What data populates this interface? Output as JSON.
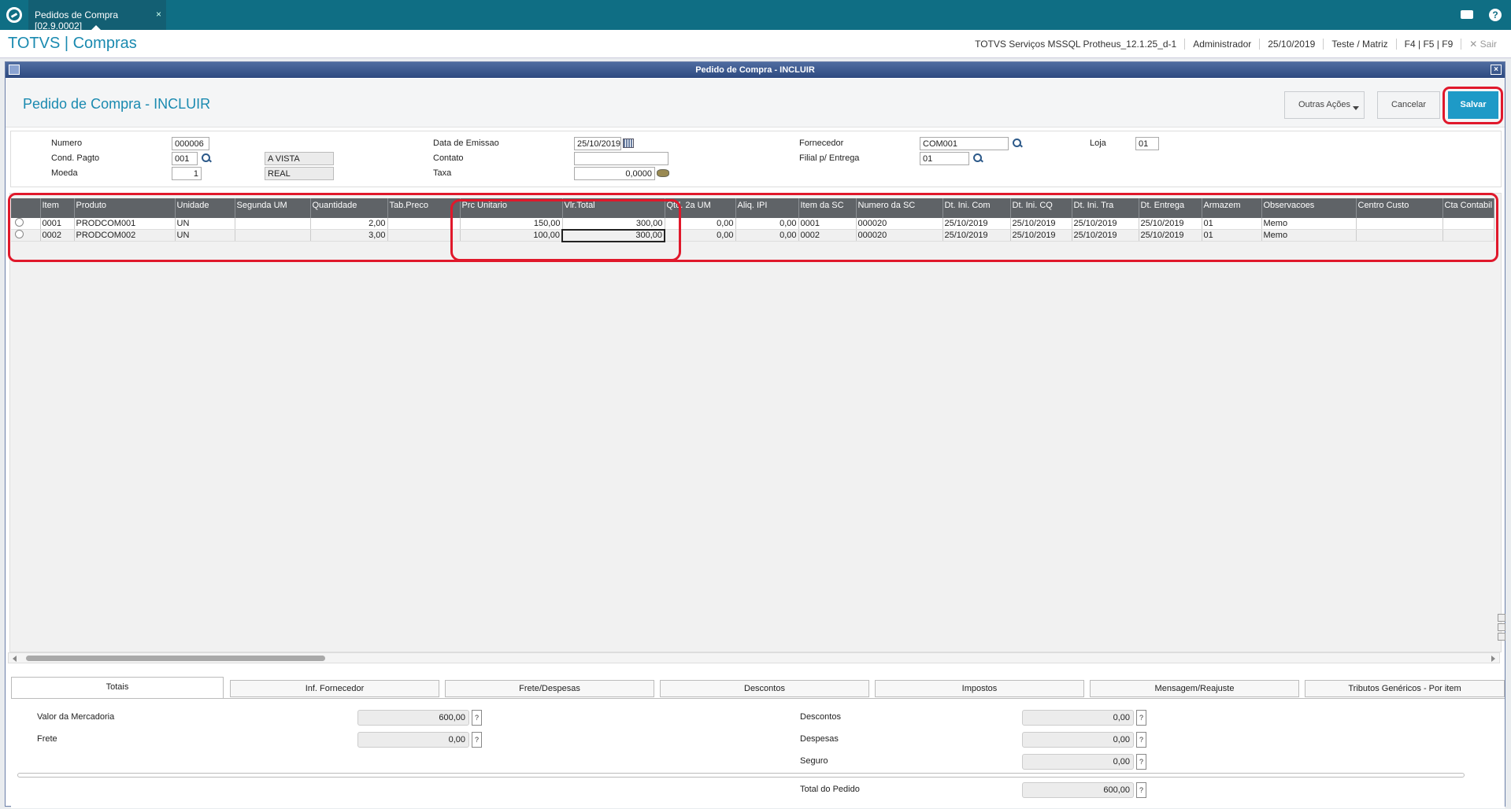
{
  "tabbar": {
    "tab_label": "Pedidos de Compra [02.9.0002]",
    "tab_close": "×",
    "help": "?"
  },
  "header": {
    "brand": "TOTVS | Compras",
    "environment": "TOTVS Serviços MSSQL Protheus_12.1.25_d-1",
    "user": "Administrador",
    "date": "25/10/2019",
    "branch": "Teste / Matriz",
    "shortcuts": "F4 | F5 | F9",
    "logout": "✕  Sair"
  },
  "dialog": {
    "title": "Pedido de Compra - INCLUIR",
    "close": "×",
    "page_title": "Pedido de Compra - INCLUIR",
    "buttons": {
      "outras": "Outras Ações",
      "cancelar": "Cancelar",
      "salvar": "Salvar"
    }
  },
  "form": {
    "numero_label": "Numero",
    "numero": "000006",
    "cond_label": "Cond. Pagto",
    "cond": "001",
    "cond_desc": "A VISTA",
    "moeda_label": "Moeda",
    "moeda": "1",
    "moeda_desc": "REAL",
    "emissao_label": "Data de Emissao",
    "emissao": "25/10/2019",
    "contato_label": "Contato",
    "contato": "",
    "taxa_label": "Taxa",
    "taxa": "0,0000",
    "fornecedor_label": "Fornecedor",
    "fornecedor": "COM001",
    "filial_label": "Filial p/ Entrega",
    "filial": "01",
    "loja_label": "Loja",
    "loja": "01"
  },
  "grid": {
    "columns": [
      "",
      "Item",
      "Produto",
      "Unidade",
      "Segunda UM",
      "Quantidade",
      "Tab.Preco",
      "Prc Unitario",
      "Vlr.Total",
      "Qtd. 2a UM",
      "Aliq. IPI",
      "Item da SC",
      "Numero da SC",
      "Dt. Ini. Com",
      "Dt. Ini. CQ",
      "Dt. Ini. Tra",
      "Dt. Entrega",
      "Armazem",
      "Observacoes",
      "Centro Custo",
      "Cta Contabil"
    ],
    "rows": [
      [
        "",
        "0001",
        "PRODCOM001",
        "UN",
        "",
        "2,00",
        "",
        "150,00",
        "300,00",
        "0,00",
        "0,00",
        "0001",
        "000020",
        "25/10/2019",
        "25/10/2019",
        "25/10/2019",
        "25/10/2019",
        "01",
        "Memo",
        "",
        ""
      ],
      [
        "",
        "0002",
        "PRODCOM002",
        "UN",
        "",
        "3,00",
        "",
        "100,00",
        "300,00",
        "0,00",
        "0,00",
        "0002",
        "000020",
        "25/10/2019",
        "25/10/2019",
        "25/10/2019",
        "25/10/2019",
        "01",
        "Memo",
        "",
        ""
      ]
    ]
  },
  "folders": [
    "Totais",
    "Inf. Fornecedor",
    "Frete/Despesas",
    "Descontos",
    "Impostos",
    "Mensagem/Reajuste",
    "Tributos Genéricos - Por item"
  ],
  "totais": {
    "mercadoria_label": "Valor da Mercadoria",
    "mercadoria": "600,00",
    "frete_label": "Frete",
    "frete": "0,00",
    "descontos_label": "Descontos",
    "descontos": "0,00",
    "despesas_label": "Despesas",
    "despesas": "0,00",
    "seguro_label": "Seguro",
    "seguro": "0,00",
    "total_label": "Total do Pedido",
    "total": "600,00",
    "help": "?"
  },
  "colors": {
    "accent": "#1a8ab0",
    "topbar": "#0f6e84",
    "save": "#1e9ac7",
    "highlight": "#e0182b",
    "grid_header": "#5f6367"
  }
}
